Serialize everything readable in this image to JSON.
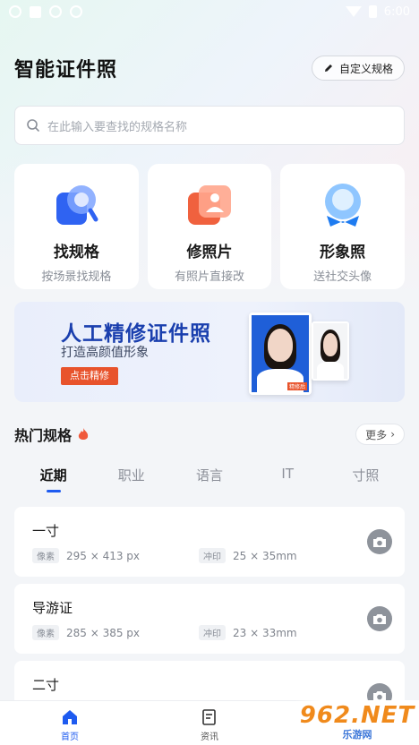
{
  "status_bar": {
    "time": "6:00"
  },
  "header": {
    "title": "智能证件照",
    "custom_button": "自定义规格"
  },
  "search": {
    "placeholder": "在此输入要查找的规格名称"
  },
  "feature_cards": [
    {
      "title": "找规格",
      "subtitle": "按场景找规格",
      "icon": "search-spec-icon"
    },
    {
      "title": "修照片",
      "subtitle": "有照片直接改",
      "icon": "edit-photo-icon"
    },
    {
      "title": "形象照",
      "subtitle": "送社交头像",
      "icon": "portrait-icon"
    }
  ],
  "banner": {
    "title": "人工精修证件照",
    "subtitle": "打造高颜值形象",
    "button": "点击精修",
    "photo_tag": "精修后"
  },
  "section": {
    "title": "热门规格",
    "more": "更多"
  },
  "tabs": [
    "近期",
    "职业",
    "语言",
    "IT",
    "寸照"
  ],
  "active_tab": "近期",
  "specs": [
    {
      "name": "一寸",
      "pixel_label": "像素",
      "pixel": "295 × 413 px",
      "print_label": "冲印",
      "print": "25 × 35mm"
    },
    {
      "name": "导游证",
      "pixel_label": "像素",
      "pixel": "285 × 385 px",
      "print_label": "冲印",
      "print": "23 × 33mm"
    },
    {
      "name": "二寸",
      "pixel_label": "",
      "pixel": "",
      "print_label": "",
      "print": ""
    }
  ],
  "bottom_nav": [
    {
      "label": "首页",
      "icon": "home-icon",
      "active": true
    },
    {
      "label": "资讯",
      "icon": "news-icon",
      "active": false
    }
  ],
  "watermark": {
    "big": "962.NET",
    "small": "乐游网"
  },
  "colors": {
    "accent": "#1e5bf0",
    "banner_title": "#1a3fae",
    "banner_button": "#e8532c"
  }
}
